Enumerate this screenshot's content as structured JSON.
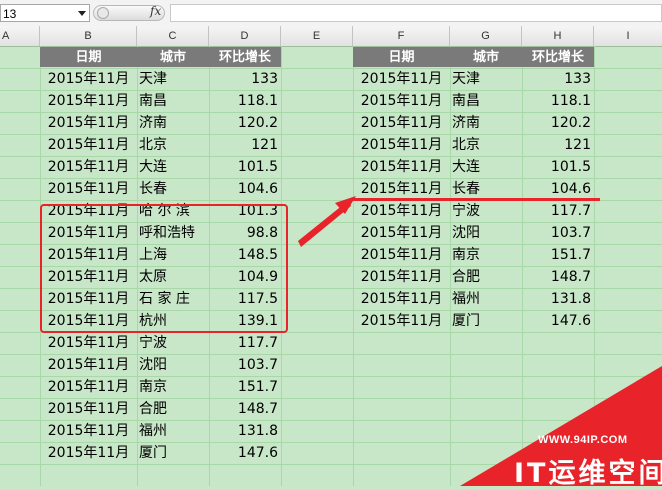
{
  "formula_bar": {
    "name_box": "13",
    "fx_label": "fx"
  },
  "columns": [
    "A",
    "B",
    "C",
    "D",
    "E",
    "F",
    "G",
    "H",
    "I"
  ],
  "left_table": {
    "headers": [
      "日期",
      "城市",
      "环比增长"
    ],
    "rows": [
      [
        "2015年11月",
        "天津",
        "133"
      ],
      [
        "2015年11月",
        "南昌",
        "118.1"
      ],
      [
        "2015年11月",
        "济南",
        "120.2"
      ],
      [
        "2015年11月",
        "北京",
        "121"
      ],
      [
        "2015年11月",
        "大连",
        "101.5"
      ],
      [
        "2015年11月",
        "长春",
        "104.6"
      ],
      [
        "2015年11月",
        "哈 尔 滨",
        "101.3"
      ],
      [
        "2015年11月",
        "呼和浩特",
        "98.8"
      ],
      [
        "2015年11月",
        "上海",
        "148.5"
      ],
      [
        "2015年11月",
        "太原",
        "104.9"
      ],
      [
        "2015年11月",
        "石 家 庄",
        "117.5"
      ],
      [
        "2015年11月",
        "杭州",
        "139.1"
      ],
      [
        "2015年11月",
        "宁波",
        "117.7"
      ],
      [
        "2015年11月",
        "沈阳",
        "103.7"
      ],
      [
        "2015年11月",
        "南京",
        "151.7"
      ],
      [
        "2015年11月",
        "合肥",
        "148.7"
      ],
      [
        "2015年11月",
        "福州",
        "131.8"
      ],
      [
        "2015年11月",
        "厦门",
        "147.6"
      ]
    ]
  },
  "right_table": {
    "headers": [
      "日期",
      "城市",
      "环比增长"
    ],
    "rows": [
      [
        "2015年11月",
        "天津",
        "133"
      ],
      [
        "2015年11月",
        "南昌",
        "118.1"
      ],
      [
        "2015年11月",
        "济南",
        "120.2"
      ],
      [
        "2015年11月",
        "北京",
        "121"
      ],
      [
        "2015年11月",
        "大连",
        "101.5"
      ],
      [
        "2015年11月",
        "长春",
        "104.6"
      ],
      [
        "2015年11月",
        "宁波",
        "117.7"
      ],
      [
        "2015年11月",
        "沈阳",
        "103.7"
      ],
      [
        "2015年11月",
        "南京",
        "151.7"
      ],
      [
        "2015年11月",
        "合肥",
        "148.7"
      ],
      [
        "2015年11月",
        "福州",
        "131.8"
      ],
      [
        "2015年11月",
        "厦门",
        "147.6"
      ]
    ]
  },
  "watermark": {
    "url": "WWW.94IP.COM",
    "brand": "IT运维空间"
  },
  "colors": {
    "header_fill": "#7a7a7a",
    "sheet_bg": "#c8e6c8",
    "gridline": "#a8d8a8",
    "annotation_red": "#e8232a"
  }
}
